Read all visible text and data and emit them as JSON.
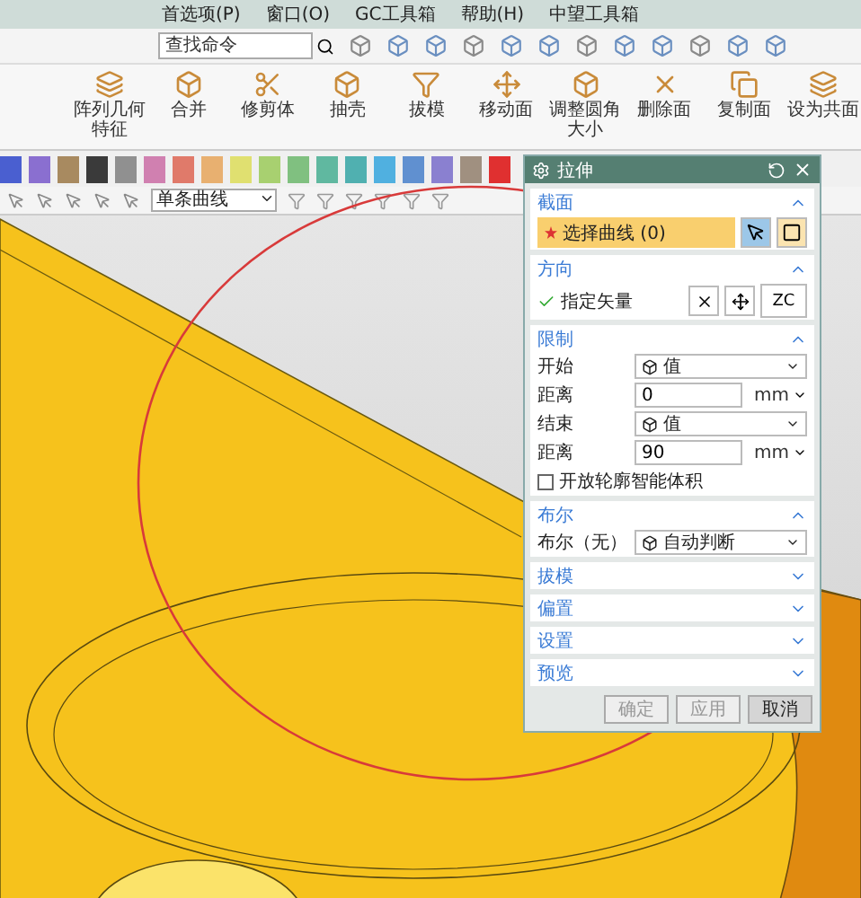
{
  "menu": [
    "首选项(P)",
    "窗口(O)",
    "GC工具箱",
    "帮助(H)",
    "中望工具箱"
  ],
  "search": {
    "placeholder": "查找命令"
  },
  "ribbon": [
    "阵列几何特征",
    "合并",
    "修剪体",
    "抽壳",
    "拔模",
    "移动面",
    "调整圆角大小",
    "删除面",
    "复制面",
    "设为共面"
  ],
  "palette": [
    {
      "color": "#4a5fd0"
    },
    {
      "color": "#8a6fd0"
    },
    {
      "color": "#a88a60"
    },
    {
      "color": "#3a3a3a"
    },
    {
      "color": "#909090"
    },
    {
      "color": "#d080b0"
    },
    {
      "color": "#e07a6a"
    },
    {
      "color": "#e8b070"
    },
    {
      "color": "#e0e070"
    },
    {
      "color": "#a8d070"
    },
    {
      "color": "#80c080"
    },
    {
      "color": "#60b8a0"
    },
    {
      "color": "#50b0b0"
    },
    {
      "color": "#50b0e0"
    },
    {
      "color": "#6090d0"
    },
    {
      "color": "#8a80d0"
    },
    {
      "color": "#a09080"
    },
    {
      "color": "#e03030"
    }
  ],
  "selection_filter": {
    "value": "单条曲线"
  },
  "dialog": {
    "title": "拉伸",
    "sections": [
      {
        "title": "截面",
        "expanded": true,
        "rows": [
          {
            "kind": "selector",
            "label": "选择曲线 (0)",
            "selected": true
          }
        ]
      },
      {
        "title": "方向",
        "expanded": true,
        "rows": [
          {
            "kind": "vector",
            "label": "指定矢量",
            "done": true,
            "axis": "ZC"
          }
        ]
      },
      {
        "title": "限制",
        "expanded": true,
        "rows": [
          {
            "kind": "dropdown",
            "label": "开始",
            "value": "值"
          },
          {
            "kind": "number",
            "label": "距离",
            "value": "0",
            "unit": "mm"
          },
          {
            "kind": "dropdown",
            "label": "结束",
            "value": "值"
          },
          {
            "kind": "number",
            "label": "距离",
            "value": "90",
            "unit": "mm"
          },
          {
            "kind": "checkbox",
            "label": "开放轮廓智能体积",
            "checked": false
          }
        ]
      },
      {
        "title": "布尔",
        "expanded": true,
        "rows": [
          {
            "kind": "dropdown",
            "label": "布尔（无）",
            "value": "自动判断"
          }
        ]
      },
      {
        "title": "拔模",
        "expanded": false
      },
      {
        "title": "偏置",
        "expanded": false
      },
      {
        "title": "设置",
        "expanded": false
      },
      {
        "title": "预览",
        "expanded": false
      }
    ],
    "buttons": [
      {
        "label": "确定",
        "disabled": true
      },
      {
        "label": "应用",
        "disabled": true
      },
      {
        "label": "取消",
        "disabled": false
      }
    ]
  }
}
